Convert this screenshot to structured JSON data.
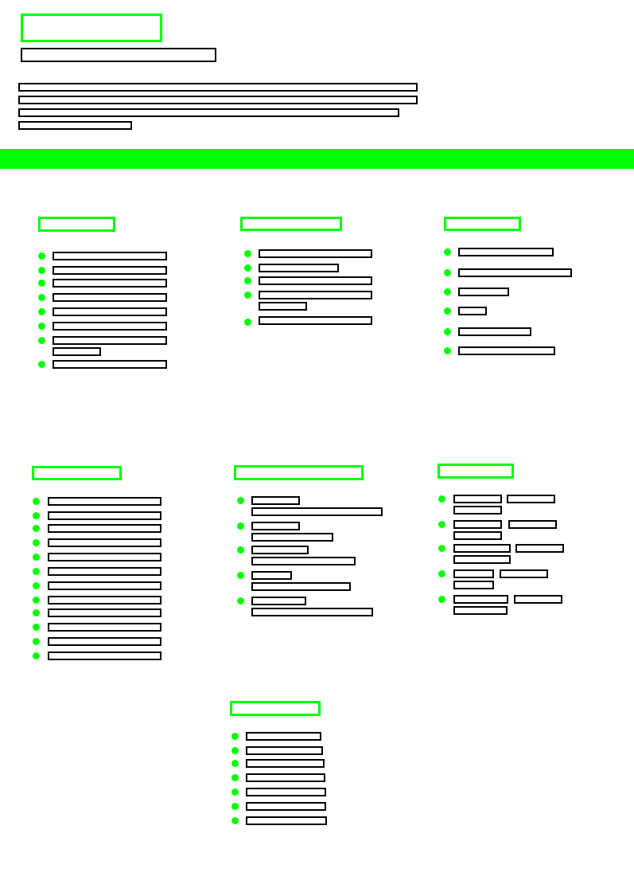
{
  "colors": {
    "accent": "#00ff00",
    "outline": "#000000",
    "background": "#ffffff"
  }
}
